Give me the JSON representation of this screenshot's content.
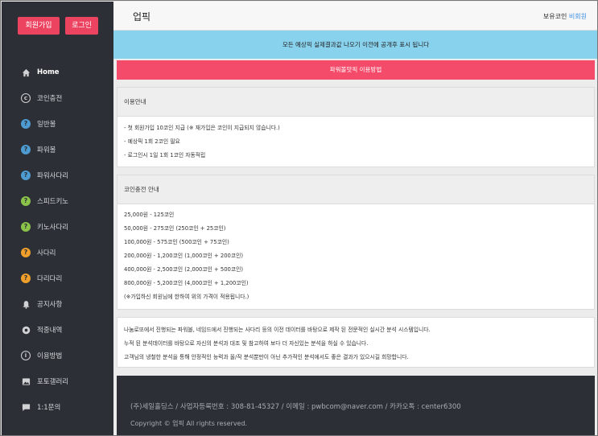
{
  "auth": {
    "join_label": "회원가입",
    "login_label": "로그인"
  },
  "nav": [
    {
      "label": "Home",
      "icon": "home-icon",
      "name": "home"
    },
    {
      "label": "코인충전",
      "icon": "coin-icon",
      "name": "coin-charge"
    },
    {
      "label": "일반볼",
      "icon": "question-icon",
      "name": "normal-ball"
    },
    {
      "label": "파워볼",
      "icon": "question-icon",
      "name": "powerball"
    },
    {
      "label": "파워사다리",
      "icon": "question-icon",
      "name": "power-ladder"
    },
    {
      "label": "스피드키노",
      "icon": "question-icon",
      "name": "speed-keno"
    },
    {
      "label": "키노사다리",
      "icon": "question-icon",
      "name": "keno-ladder"
    },
    {
      "label": "사다리",
      "icon": "question-icon",
      "name": "ladder"
    },
    {
      "label": "다리다리",
      "icon": "question-icon",
      "name": "daridari"
    },
    {
      "label": "공지사항",
      "icon": "bell-icon",
      "name": "notice"
    },
    {
      "label": "적중내역",
      "icon": "target-icon",
      "name": "hit-history"
    },
    {
      "label": "이용방법",
      "icon": "info-icon",
      "name": "how-to-use"
    },
    {
      "label": "포토갤러리",
      "icon": "photo-icon",
      "name": "photo-gallery"
    },
    {
      "label": "1:1문의",
      "icon": "chat-icon",
      "name": "inquiry"
    }
  ],
  "header": {
    "title": "업픽",
    "coin_label": "보유코인",
    "coin_value": "비회원"
  },
  "notice_blue": "모든 예상픽 실제결과값 나오기 이전에 공개후 표시 됩니다",
  "notice_red": "파워볼맛픽 이용방법",
  "usage": {
    "title": "이용안내",
    "lines": [
      "- 첫 회원가입 10코인 지급 (※ 재가입은 코인이 지급되지 않습니다.)",
      "- 예상픽 1회 2코인 필요",
      "- 로그인시 1일 1회 1코인 자동적립"
    ]
  },
  "charge": {
    "title": "코인충전 안내",
    "lines": [
      "25,000원 - 125코인",
      "50,000원 - 275코인 (250코인 + 25코인)",
      "100,000원 - 575코인 (500코인 + 75코인)",
      "200,000원 - 1,200코인 (1,000코인 + 200코인)",
      "400,000원 - 2,500코인 (2,000코인 + 500코인)",
      "800,000원 - 5,200코인 (4,000코인 + 1,200코인)",
      "(※가입하신 회원님에 한하여 위의 가격이 적용됩니다.)"
    ]
  },
  "about": {
    "lines": [
      "나눔로또에서 진행되는 파워볼, 네임드에서 진행되는 사다리 등의 이전 데이터를 바탕으로 제작 된 전문적인 실시간 분석 시스템입니다.",
      "누적 된 분석데이터를 바탕으로 자신의 분석과 대조 및 참고하여 보다 더 자신있는 분석을 하실 수 있습니다.",
      "고객님의 냉철한 분석을 통해 안정적인 능력과 올/작 분석뿐만이 아닌 추가적인 분석에서도 좋은 결과가 있으시길 희망합니다."
    ]
  },
  "footer": {
    "line1": "(주)세일홀딩스 / 사업자등록번호 : 308-81-45327 / 이메일 : pwbcom@naver.com / 카카오톡 : center6300",
    "line2": "Copyright © 업픽 All rights reserved."
  }
}
